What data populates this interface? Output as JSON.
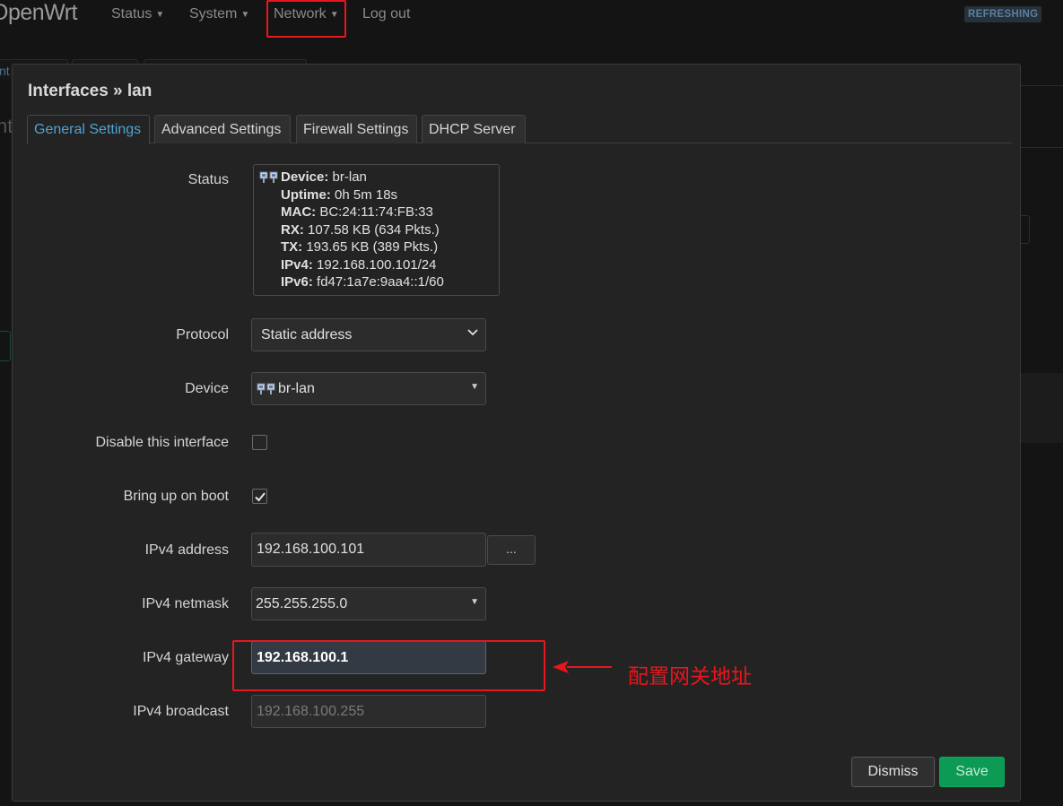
{
  "navbar": {
    "brand": "OpenWrt",
    "items": [
      {
        "label": "Status",
        "has_caret": true
      },
      {
        "label": "System",
        "has_caret": true
      },
      {
        "label": "Network",
        "has_caret": true
      },
      {
        "label": "Log out",
        "has_caret": false
      }
    ],
    "caret_icon": "caret-down-icon",
    "badge": "REFRESHING"
  },
  "background": {
    "tab_fragment": "nt",
    "title_fragment": "nt"
  },
  "modal": {
    "title": "Interfaces » lan",
    "tabs": [
      {
        "label": "General Settings",
        "active": true
      },
      {
        "label": "Advanced Settings",
        "active": false
      },
      {
        "label": "Firewall Settings",
        "active": false
      },
      {
        "label": "DHCP Server",
        "active": false
      }
    ],
    "status": {
      "label": "Status",
      "icon": "network-device-icon",
      "device_key": "Device:",
      "device_value": "br-lan",
      "uptime_key": "Uptime:",
      "uptime_value": "0h 5m 18s",
      "mac_key": "MAC:",
      "mac_value": "BC:24:11:74:FB:33",
      "rx_key": "RX:",
      "rx_value": "107.58 KB (634 Pkts.)",
      "tx_key": "TX:",
      "tx_value": "193.65 KB (389 Pkts.)",
      "ipv4_key": "IPv4:",
      "ipv4_value": "192.168.100.101/24",
      "ipv6_key": "IPv6:",
      "ipv6_value": "fd47:1a7e:9aa4::1/60"
    },
    "fields": {
      "protocol": {
        "label": "Protocol",
        "value": "Static address"
      },
      "device": {
        "label": "Device",
        "value": "br-lan"
      },
      "disable": {
        "label": "Disable this interface",
        "checked": false
      },
      "boot": {
        "label": "Bring up on boot",
        "checked": true
      },
      "ipv4_address": {
        "label": "IPv4 address",
        "value": "192.168.100.101",
        "extra_button": "..."
      },
      "ipv4_netmask": {
        "label": "IPv4 netmask",
        "value": "255.255.255.0"
      },
      "ipv4_gateway": {
        "label": "IPv4 gateway",
        "value": "192.168.100.1"
      },
      "ipv4_broadcast": {
        "label": "IPv4 broadcast",
        "placeholder": "192.168.100.255"
      }
    },
    "buttons": {
      "dismiss": "Dismiss",
      "save": "Save"
    }
  },
  "annotation": {
    "text": "配置网关地址",
    "color": "#e8161d"
  },
  "colors": {
    "accent_tab": "#4fa3d1",
    "save_green": "#0d9a55",
    "highlight_red": "#e8161d"
  }
}
